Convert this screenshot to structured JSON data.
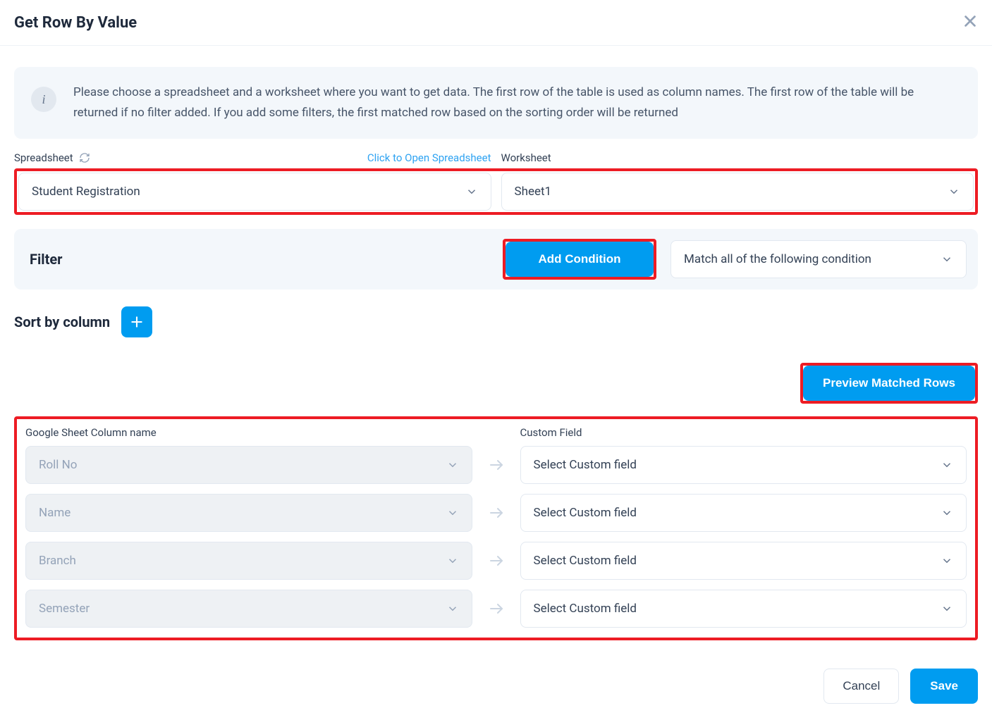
{
  "header": {
    "title": "Get Row By Value"
  },
  "info": {
    "text": "Please choose a spreadsheet and a worksheet where you want to get data. The first row of the table is used as column names. The first row of the table will be returned if no filter added. If you add some filters, the first matched row based on the sorting order will be returned"
  },
  "labels": {
    "spreadsheet": "Spreadsheet",
    "open_link": "Click to Open Spreadsheet",
    "worksheet": "Worksheet",
    "filter": "Filter",
    "add_condition": "Add Condition",
    "match_condition": "Match all of the following condition",
    "sort_by_column": "Sort by column",
    "preview": "Preview Matched Rows",
    "column_name_header": "Google Sheet Column name",
    "custom_field_header": "Custom Field",
    "select_custom_field": "Select Custom field",
    "cancel": "Cancel",
    "save": "Save"
  },
  "selections": {
    "spreadsheet": "Student Registration",
    "worksheet": "Sheet1"
  },
  "mappings": [
    {
      "column": "Roll No"
    },
    {
      "column": "Name"
    },
    {
      "column": "Branch"
    },
    {
      "column": "Semester"
    }
  ]
}
